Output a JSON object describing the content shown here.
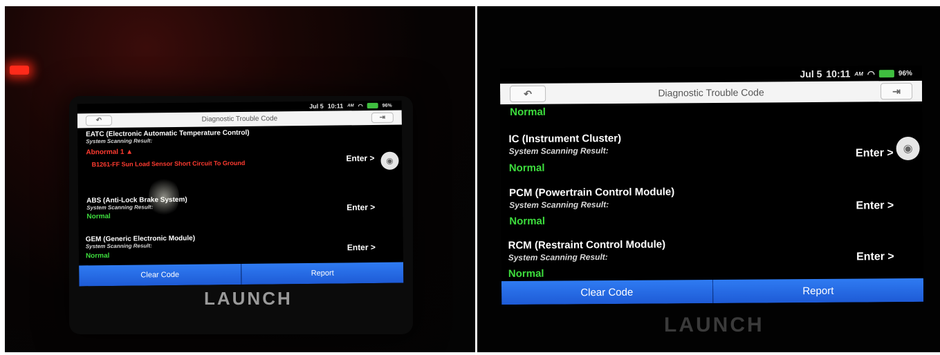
{
  "left_device": {
    "status_bar": {
      "date": "Jul 5",
      "time": "10:11",
      "ampm": "AM",
      "battery": "96%"
    },
    "header": {
      "title": "Diagnostic Trouble Code"
    },
    "modules": [
      {
        "name": "EATC (Electronic Automatic Temperature Control)",
        "sub": "System Scanning Result:",
        "result": "Abnormal 1",
        "enter": "Enter >",
        "dtc": "B1261-FF Sun Load Sensor Short Circuit To Ground"
      },
      {
        "name": "ABS (Anti-Lock Brake System)",
        "sub": "System Scanning Result:",
        "result": "Normal",
        "enter": "Enter >"
      },
      {
        "name": "GEM (Generic Electronic Module)",
        "sub": "System Scanning Result:",
        "result": "Normal",
        "enter": "Enter >"
      }
    ],
    "buttons": {
      "clear": "Clear Code",
      "report": "Report"
    },
    "brand": "LAUNCH"
  },
  "right_device": {
    "status_bar": {
      "date": "Jul 5",
      "time": "10:11",
      "ampm": "AM",
      "battery": "96%"
    },
    "header": {
      "title": "Diagnostic Trouble Code"
    },
    "top_partial": "Normal",
    "modules": [
      {
        "name": "IC (Instrument Cluster)",
        "sub": "System Scanning Result:",
        "result": "Normal",
        "enter": "Enter >"
      },
      {
        "name": "PCM (Powertrain Control Module)",
        "sub": "System Scanning Result:",
        "result": "Normal",
        "enter": "Enter >"
      },
      {
        "name": "RCM (Restraint Control Module)",
        "sub": "System Scanning Result:",
        "result": "Normal",
        "enter": "Enter >"
      }
    ],
    "buttons": {
      "clear": "Clear Code",
      "report": "Report"
    },
    "brand": "LAUNCH"
  },
  "colors": {
    "normal": "#3ddc3d",
    "abnormal": "#ff3b30",
    "button_blue": "#2468e0",
    "led": "#ff2a1a"
  },
  "icons": [
    "back-arrow-icon",
    "exit-icon",
    "camera-icon",
    "wifi-icon",
    "battery-icon",
    "caret-up-icon"
  ]
}
